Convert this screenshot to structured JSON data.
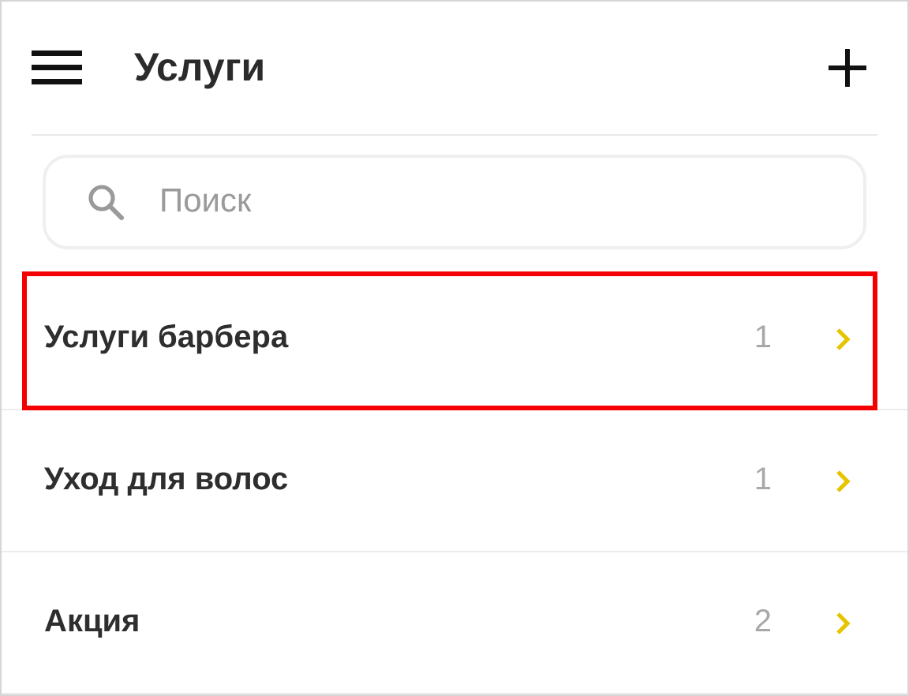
{
  "header": {
    "title": "Услуги"
  },
  "search": {
    "placeholder": "Поиск"
  },
  "items": [
    {
      "label": "Услуги барбера",
      "count": "1",
      "highlighted": true
    },
    {
      "label": "Уход для волос",
      "count": "1",
      "highlighted": false
    },
    {
      "label": "Акция",
      "count": "2",
      "highlighted": false
    }
  ]
}
